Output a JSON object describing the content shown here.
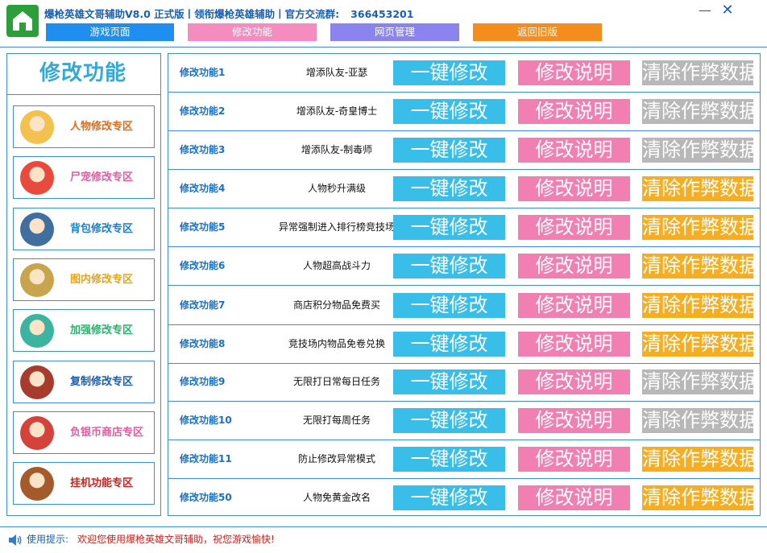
{
  "window": {
    "title": "爆枪英雄文哥辅助V8.0 正式版丨领衔爆枪英雄辅助丨官方交流群:",
    "qq_group": "366453201",
    "minimize_symbol": "—",
    "close_symbol": "✕"
  },
  "nav_tabs": [
    {
      "label": "游戏页面",
      "color": "#1e8ff0"
    },
    {
      "label": "修改功能",
      "color": "#f48cc0"
    },
    {
      "label": "网页管理",
      "color": "#8b84f0"
    },
    {
      "label": "返回旧版",
      "color": "#f58c1e"
    }
  ],
  "sidebar": {
    "title": "修改功能",
    "items": [
      {
        "label": "人物修改专区",
        "color": "#e46b16",
        "avatar_color": "#f2c14e",
        "icon": "hero-avatar-icon"
      },
      {
        "label": "尸宠修改专区",
        "color": "#e85aa0",
        "avatar_color": "#e94a3d",
        "icon": "zombie-pet-avatar-icon"
      },
      {
        "label": "背包修改专区",
        "color": "#1a7fd0",
        "avatar_color": "#3f6e9f",
        "icon": "backpack-avatar-icon"
      },
      {
        "label": "图内修改专区",
        "color": "#e8a515",
        "avatar_color": "#c8a44c",
        "icon": "map-avatar-icon"
      },
      {
        "label": "加强修改专区",
        "color": "#27b46a",
        "avatar_color": "#3cb4a0",
        "icon": "enhance-avatar-icon"
      },
      {
        "label": "复制修改专区",
        "color": "#1a5fb4",
        "avatar_color": "#a63b2e",
        "icon": "copy-avatar-icon"
      },
      {
        "label": "负银币商店专区",
        "color": "#e85aa0",
        "avatar_color": "#d4433b",
        "icon": "shop-avatar-icon"
      },
      {
        "label": "挂机功能专区",
        "color": "#d0211c",
        "avatar_color": "#a45a2a",
        "icon": "afk-avatar-icon"
      }
    ]
  },
  "functions": [
    {
      "id": "修改功能1",
      "desc": "增添队友-亚瑟",
      "clear_state": "gray"
    },
    {
      "id": "修改功能2",
      "desc": "增添队友-奇皇博士",
      "clear_state": "gray"
    },
    {
      "id": "修改功能3",
      "desc": "增添队友-制毒师",
      "clear_state": "gray"
    },
    {
      "id": "修改功能4",
      "desc": "人物秒升满级",
      "clear_state": "orange"
    },
    {
      "id": "修改功能5",
      "desc": "异常强制进入排行榜竞技场",
      "clear_state": "orange"
    },
    {
      "id": "修改功能6",
      "desc": "人物超高战斗力",
      "clear_state": "orange"
    },
    {
      "id": "修改功能7",
      "desc": "商店积分物品免费买",
      "clear_state": "orange"
    },
    {
      "id": "修改功能8",
      "desc": "竞技场内物品免卷兑换",
      "clear_state": "orange"
    },
    {
      "id": "修改功能9",
      "desc": "无限打日常每日任务",
      "clear_state": "gray"
    },
    {
      "id": "修改功能10",
      "desc": "无限打每周任务",
      "clear_state": "gray"
    },
    {
      "id": "修改功能11",
      "desc": "防止修改异常模式",
      "clear_state": "orange"
    },
    {
      "id": "修改功能50",
      "desc": "人物免黄金改名",
      "clear_state": "orange"
    }
  ],
  "buttons": {
    "modify_label": "一键修改",
    "info_label": "修改说明",
    "clear_label": "清除作弊数据"
  },
  "status": {
    "label": "使用提示:",
    "message": "欢迎您使用爆枪英雄文哥辅助，祝您游戏愉快!"
  },
  "colors": {
    "accent_blue": "#3f8fd6",
    "modify_button": "#39bde9",
    "info_button": "#f27fb2",
    "clear_button_active": "#f5ad22",
    "clear_button_inactive": "#b8b8b8"
  }
}
